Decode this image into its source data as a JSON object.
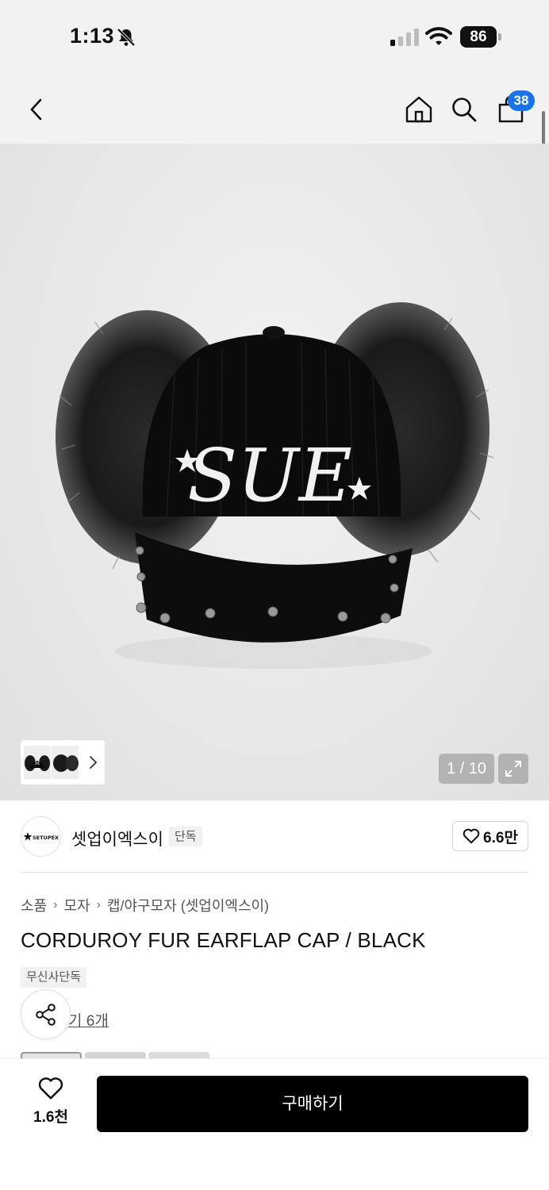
{
  "status_bar": {
    "time": "1:13",
    "battery": "86",
    "icons": [
      "bell-slash-icon",
      "signal-icon",
      "wifi-icon",
      "battery-icon"
    ]
  },
  "nav": {
    "cart_count": "38",
    "icons": [
      "back-chevron-icon",
      "home-icon",
      "search-icon",
      "cart-bag-icon"
    ]
  },
  "gallery": {
    "counter": "1 / 10",
    "current_image": 1,
    "total_images": 10,
    "embroidery_text": "SUE"
  },
  "brand": {
    "logo_text": "SETUPEXE",
    "name": "셋업이엑스이",
    "exclusive_tag": "단독",
    "like_count": "6.6만"
  },
  "breadcrumb": [
    "소품",
    "모자",
    "캡/야구모자 (셋업이엑스이)"
  ],
  "product": {
    "title": "CORDUROY FUR EARFLAP CAP / BLACK",
    "badge": "무신사단독",
    "review_text": "기 6개"
  },
  "bottom_bar": {
    "wish_count": "1.6천",
    "buy_label": "구매하기"
  },
  "colors": {
    "accent_badge": "#1a73e8",
    "buy_button": "#000000",
    "header_bg": "#f2f2f2"
  }
}
